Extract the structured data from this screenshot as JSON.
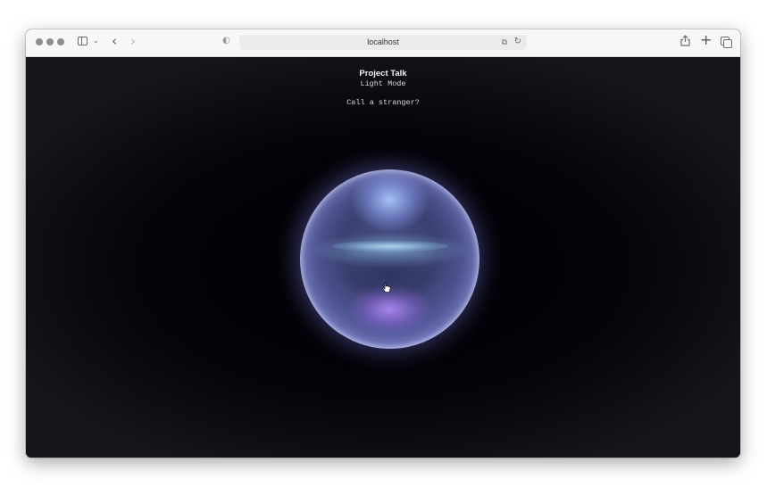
{
  "browser": {
    "address": "localhost",
    "icons": [
      "sidebar-icon",
      "chevron-down-icon",
      "back-icon",
      "forward-icon",
      "shield-icon",
      "translate-icon",
      "reload-icon",
      "share-icon",
      "new-tab-icon",
      "tabs-overview-icon"
    ]
  },
  "page": {
    "title": "Project Talk",
    "mode_label": "Light Mode",
    "prompt": "Call a stranger?"
  },
  "colors": {
    "background": "#050409",
    "orb_accent": "#8e95e4",
    "orb_highlight": "#b7bcff"
  }
}
